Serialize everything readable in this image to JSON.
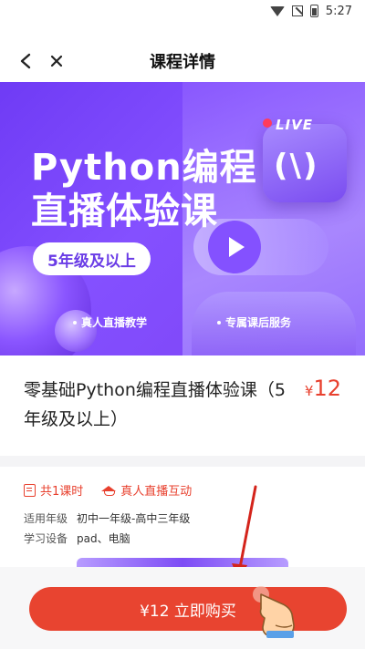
{
  "status_bar": {
    "time": "5:27",
    "icons": [
      "wifi-icon",
      "signal-icon",
      "battery-icon"
    ]
  },
  "nav": {
    "title": "课程详情",
    "back_icon": "chevron-left-icon",
    "close_icon": "close-icon"
  },
  "banner": {
    "title_line1": "Python编程",
    "title_line2": "直播体验课",
    "grade_pill": "5年级及以上",
    "live_label": "LIVE",
    "live_code": "(\\)",
    "features": [
      "真人直播教学",
      "专属课后服务"
    ]
  },
  "course": {
    "name": "零基础Python编程直播体验课（5年级及以上）",
    "price_symbol": "¥",
    "price": "12"
  },
  "meta": {
    "tags": [
      "共1课时",
      "真人直播互动"
    ],
    "rows": [
      {
        "label": "适用年级",
        "value": "初中一年级-高中三年级"
      },
      {
        "label": "学习设备",
        "value": "pad、电脑"
      }
    ]
  },
  "buy": {
    "label": "¥12 立即购买"
  },
  "colors": {
    "accent": "#e84430",
    "banner": "#7d42f4"
  }
}
